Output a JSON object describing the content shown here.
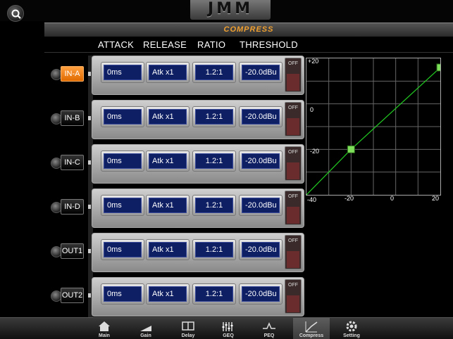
{
  "app": {
    "logo_text": "JMM",
    "title": "COMPRESS"
  },
  "columns": [
    "ATTACK",
    "RELEASE",
    "RATIO",
    "THRESHOLD"
  ],
  "rows": [
    {
      "channel": "IN-A",
      "letter": "A",
      "attack": "0ms",
      "release": "Atk x1",
      "ratio": "1.2:1",
      "threshold": "-20.0dBu",
      "off_label": "OFF",
      "active": true
    },
    {
      "channel": "IN-B",
      "letter": "B",
      "attack": "0ms",
      "release": "Atk x1",
      "ratio": "1.2:1",
      "threshold": "-20.0dBu",
      "off_label": "OFF",
      "active": false
    },
    {
      "channel": "IN-C",
      "letter": "C",
      "attack": "0ms",
      "release": "Atk x1",
      "ratio": "1.2:1",
      "threshold": "-20.0dBu",
      "off_label": "OFF",
      "active": false
    },
    {
      "channel": "IN-D",
      "letter": "D",
      "attack": "0ms",
      "release": "Atk x1",
      "ratio": "1.2:1",
      "threshold": "-20.0dBu",
      "off_label": "OFF",
      "active": false
    },
    {
      "channel": "OUT1",
      "letter": "1",
      "attack": "0ms",
      "release": "Atk x1",
      "ratio": "1.2:1",
      "threshold": "-20.0dBu",
      "off_label": "OFF",
      "active": false
    },
    {
      "channel": "OUT2",
      "letter": "2",
      "attack": "0ms",
      "release": "Atk x1",
      "ratio": "1.2:1",
      "threshold": "-20.0dBu",
      "off_label": "OFF",
      "active": false
    }
  ],
  "graph": {
    "y_ticks": [
      "+20",
      "0",
      "-20",
      "-40"
    ],
    "x_ticks": [
      "-20",
      "0",
      "20"
    ],
    "line_color": "#22cc22",
    "handle_color": "#7ee05a",
    "grid_color": "#666666"
  },
  "chart_data": {
    "type": "line",
    "x": [
      -40,
      -20,
      20
    ],
    "y": [
      -40,
      -20,
      16
    ],
    "xlim": [
      -40,
      20
    ],
    "ylim": [
      -40,
      20
    ],
    "grid": true
  },
  "tabs": [
    {
      "label": "Main",
      "icon": "home-icon",
      "active": false
    },
    {
      "label": "Gain",
      "icon": "gain-icon",
      "active": false
    },
    {
      "label": "Delay",
      "icon": "delay-icon",
      "active": false
    },
    {
      "label": "GEQ",
      "icon": "geq-icon",
      "active": false
    },
    {
      "label": "PEQ",
      "icon": "peq-icon",
      "active": false
    },
    {
      "label": "Compress",
      "icon": "compress-icon",
      "active": true
    },
    {
      "label": "Setting",
      "icon": "gear-icon",
      "active": false
    }
  ]
}
